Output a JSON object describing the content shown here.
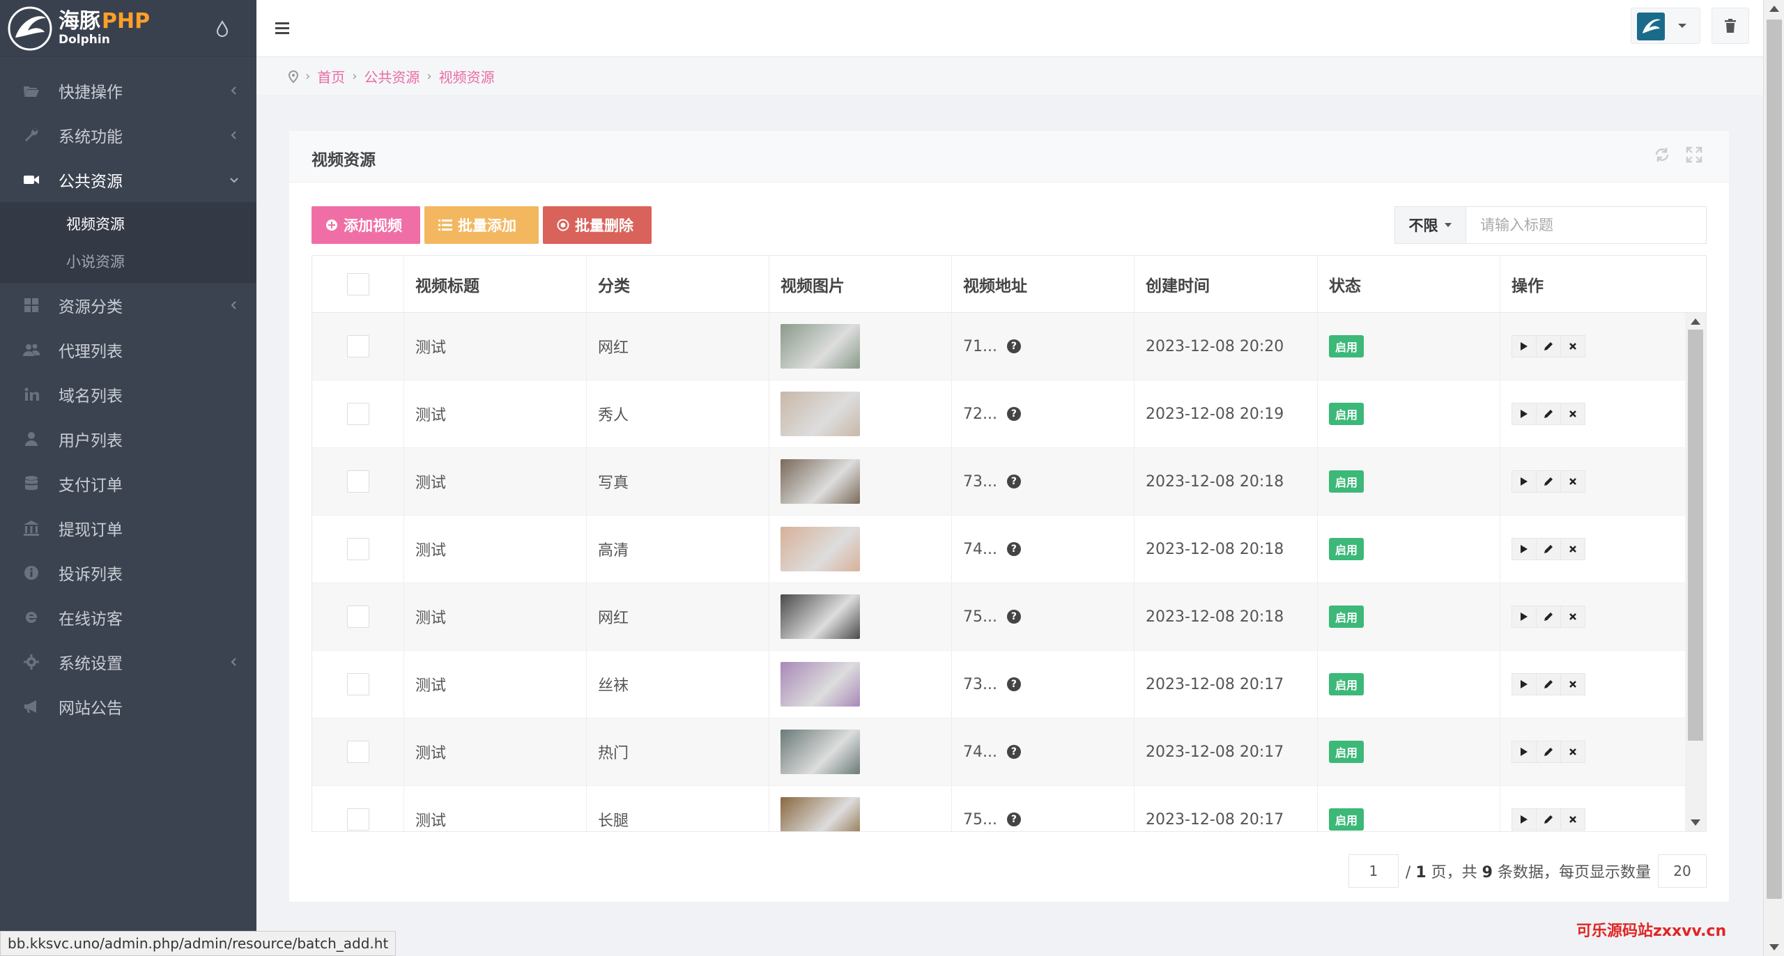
{
  "brand": {
    "cn": "海豚",
    "php": "PHP",
    "en": "Dolphin"
  },
  "sidebar": {
    "items": [
      {
        "label": "快捷操作",
        "icon": "folder-open-icon",
        "has_arrow": true
      },
      {
        "label": "系统功能",
        "icon": "wrench-icon",
        "has_arrow": true
      },
      {
        "label": "公共资源",
        "icon": "video-camera-icon",
        "has_arrow": true,
        "active": true
      },
      {
        "label": "资源分类",
        "icon": "grid-icon",
        "has_arrow": true
      },
      {
        "label": "代理列表",
        "icon": "users-icon",
        "has_arrow": false
      },
      {
        "label": "域名列表",
        "icon": "linkedin-icon",
        "has_arrow": false
      },
      {
        "label": "用户列表",
        "icon": "user-icon",
        "has_arrow": false
      },
      {
        "label": "支付订单",
        "icon": "database-icon",
        "has_arrow": false
      },
      {
        "label": "提现订单",
        "icon": "bank-icon",
        "has_arrow": false
      },
      {
        "label": "投诉列表",
        "icon": "info-circle-icon",
        "has_arrow": false
      },
      {
        "label": "在线访客",
        "icon": "ie-icon",
        "has_arrow": false
      },
      {
        "label": "系统设置",
        "icon": "gear-icon",
        "has_arrow": true
      },
      {
        "label": "网站公告",
        "icon": "bullhorn-icon",
        "has_arrow": false
      }
    ],
    "subitems": [
      {
        "label": "视频资源",
        "active": true
      },
      {
        "label": "小说资源",
        "active": false
      }
    ]
  },
  "breadcrumb": {
    "items": [
      "首页",
      "公共资源",
      "视频资源"
    ]
  },
  "card": {
    "title": "视频资源"
  },
  "toolbar": {
    "add_label": "添加视频",
    "batch_add_label": "批量添加",
    "batch_delete_label": "批量删除"
  },
  "search": {
    "select_value": "不限",
    "placeholder": "请输入标题"
  },
  "table": {
    "headers": [
      "视频标题",
      "分类",
      "视频图片",
      "视频地址",
      "创建时间",
      "状态",
      "操作"
    ],
    "rows": [
      {
        "title": "测试",
        "category": "网红",
        "addr": "71...",
        "time": "2023-12-08 20:20",
        "status": "启用",
        "thumb": "#8a9a8a"
      },
      {
        "title": "测试",
        "category": "秀人",
        "addr": "72...",
        "time": "2023-12-08 20:19",
        "status": "启用",
        "thumb": "#c8b8a8"
      },
      {
        "title": "测试",
        "category": "写真",
        "addr": "73...",
        "time": "2023-12-08 20:18",
        "status": "启用",
        "thumb": "#7a6a5a"
      },
      {
        "title": "测试",
        "category": "高清",
        "addr": "74...",
        "time": "2023-12-08 20:18",
        "status": "启用",
        "thumb": "#d8b098"
      },
      {
        "title": "测试",
        "category": "网红",
        "addr": "75...",
        "time": "2023-12-08 20:18",
        "status": "启用",
        "thumb": "#4a4a4a"
      },
      {
        "title": "测试",
        "category": "丝袜",
        "addr": "73...",
        "time": "2023-12-08 20:17",
        "status": "启用",
        "thumb": "#a888b8"
      },
      {
        "title": "测试",
        "category": "热门",
        "addr": "74...",
        "time": "2023-12-08 20:17",
        "status": "启用",
        "thumb": "#6a7a78"
      },
      {
        "title": "测试",
        "category": "长腿",
        "addr": "75...",
        "time": "2023-12-08 20:17",
        "status": "启用",
        "thumb": "#8a6840"
      }
    ]
  },
  "pager": {
    "page": "1",
    "total_pages": "1",
    "total_count": "9",
    "page_size": "20",
    "text_pages_prefix": "/",
    "text_pages_suffix": "页，共",
    "text_count_suffix": "条数据，每页显示数量"
  },
  "status_url": "bb.kksvc.uno/admin.php/admin/resource/batch_add.ht",
  "watermark": "可乐源码站zxxvv.cn",
  "colors": {
    "accent": "#ea6ba6",
    "sidebar": "#3c4350",
    "success": "#3cb878"
  }
}
